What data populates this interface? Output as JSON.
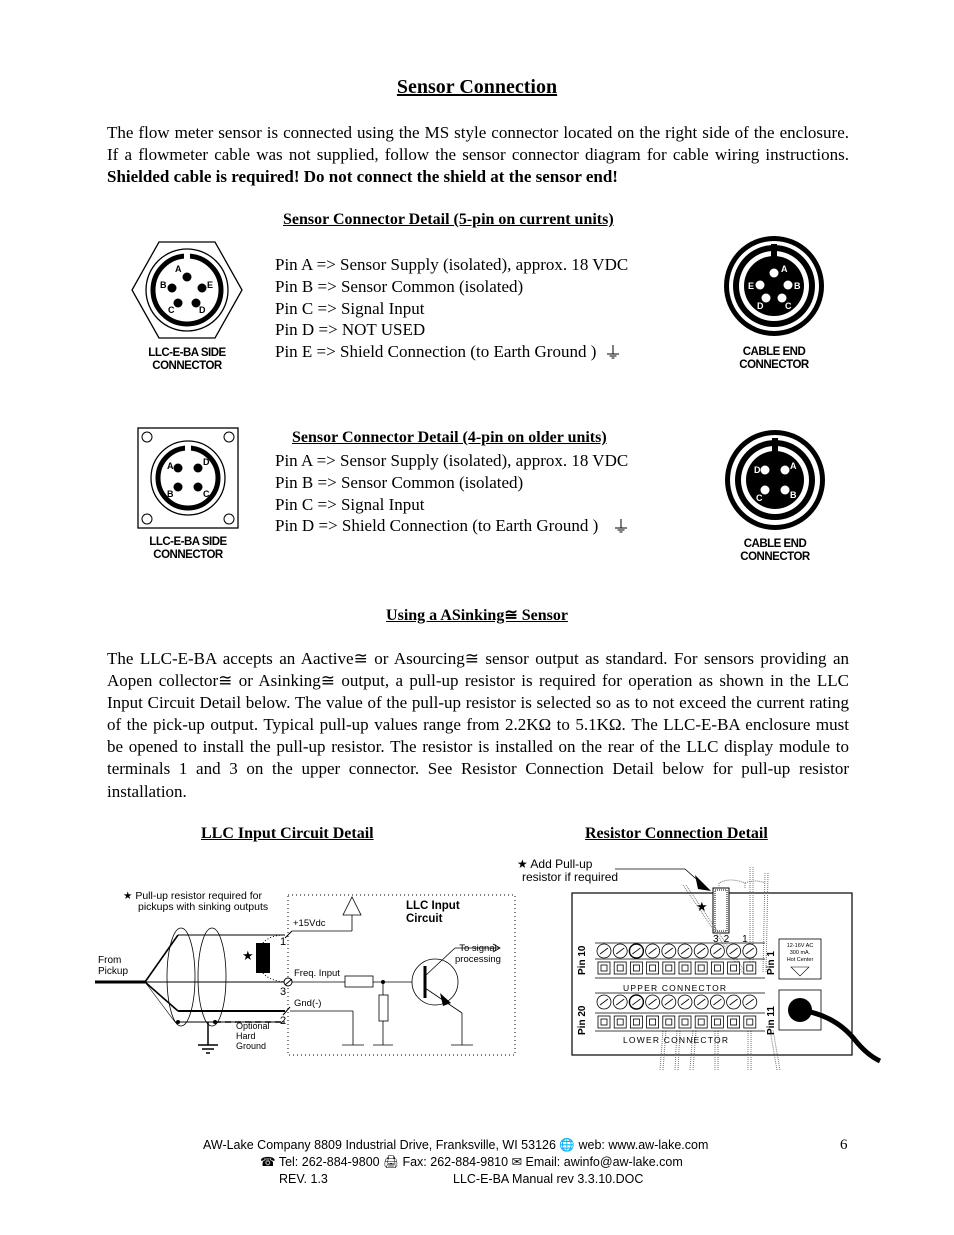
{
  "page": {
    "title": "Sensor Connection",
    "intro": {
      "normal": "The flow meter sensor is connected using the MS style connector located on the right side of the enclosure.  If a flowmeter cable was not supplied, follow the sensor connector diagram for cable wiring instructions. ",
      "bold": "Shielded cable is required! Do not connect the shield at the sensor end!"
    },
    "five_pin": {
      "heading": "Sensor Connector Detail (5-pin on current units)",
      "pins": [
        "Pin A => Sensor Supply (isolated), approx. 18 VDC",
        "Pin B => Sensor Common (isolated)",
        "Pin C => Signal Input",
        "Pin D => NOT USED",
        "Pin E => Shield Connection (to Earth Ground )"
      ],
      "side_connector": {
        "label_line1": "LLC-E-BA SIDE",
        "label_line2": "CONNECTOR",
        "pins": [
          "A",
          "B",
          "C",
          "D",
          "E"
        ]
      },
      "cable_connector": {
        "label_line1": "CABLE END",
        "label_line2": "CONNECTOR",
        "pins": [
          "A",
          "B",
          "C",
          "D",
          "E"
        ]
      }
    },
    "four_pin": {
      "heading": "Sensor Connector Detail (4-pin on older units)",
      "pins": [
        "Pin A => Sensor Supply (isolated), approx. 18 VDC",
        "Pin B => Sensor Common (isolated)",
        "Pin C => Signal Input",
        "Pin D => Shield Connection (to Earth Ground )"
      ],
      "side_connector": {
        "label_line1": "LLC-E-BA SIDE",
        "label_line2": "CONNECTOR",
        "pins": [
          "A",
          "B",
          "C",
          "D"
        ]
      },
      "cable_connector": {
        "label_line1": "CABLE END",
        "label_line2": "CONNECTOR",
        "pins": [
          "A",
          "B",
          "C",
          "D"
        ]
      }
    },
    "sinking": {
      "heading": "Using a ASinking≅ Sensor",
      "body": "The LLC-E-BA accepts an Aactive≅ or Asourcing≅ sensor output as standard.  For sensors providing an Aopen collector≅ or Asinking≅ output, a pull-up resistor is required for operation as shown in the LLC Input Circuit Detail below. The value of the pull-up resistor is selected so as to not exceed the current rating of the pick-up output.  Typical pull-up values range from 2.2KΩ to 5.1KΩ. The LLC-E-BA enclosure must be opened to install the pull-up resistor. The resistor is installed on the rear of the LLC display module to terminals 1 and 3 on the upper connector.  See Resistor Connection Detail below for pull-up resistor installation."
    },
    "circuit_detail": {
      "heading": "LLC Input Circuit Detail",
      "note_line1": "★ Pull-up resistor required for",
      "note_line2": "pickups with sinking outputs",
      "from_pickup_1": "From",
      "from_pickup_2": "Pickup",
      "terminal_1": "1",
      "terminal_3": "3",
      "terminal_2": "2",
      "v15": "+15Vdc",
      "freq_input": "Freq. Input",
      "gnd": "Gnd(-)",
      "optional_1": "Optional",
      "optional_2": "Hard",
      "optional_3": "Ground",
      "circuit_title_1": "LLC Input",
      "circuit_title_2": "Circuit",
      "to_signal_1": "To signal",
      "to_signal_2": "processing",
      "star": "★"
    },
    "resistor_detail": {
      "heading": "Resistor Connection Detail",
      "note_line1": "★ Add Pull-up",
      "note_line2": "resistor if required",
      "star": "★",
      "terminal_labels": [
        "3",
        "2",
        "1"
      ],
      "pin10": "Pin 10",
      "pin1": "Pin 1",
      "pin20": "Pin 20",
      "pin11": "Pin 11",
      "upper_connector": "UPPER CONNECTOR",
      "lower_connector": "LOWER CONNECTOR",
      "power_label_1": "12-16V AC",
      "power_label_2": "300 mA.",
      "power_label_3": "Hot Center"
    },
    "footer": {
      "line1": "AW-Lake Company 8809 Industrial Drive, Franksville, WI 53126",
      "web": "web: www.aw-lake.com",
      "tel": "Tel:  262-884-9800",
      "fax": "Fax:  262-884-9810",
      "email": "Email: awinfo@aw-lake.com",
      "rev": "REV. 1.3",
      "doc": "LLC-E-BA Manual rev 3.3.10.DOC",
      "page_number": "6",
      "icons": {
        "globe": "globe-icon",
        "phone": "phone-icon",
        "fax": "fax-icon",
        "email": "email-icon"
      }
    }
  }
}
